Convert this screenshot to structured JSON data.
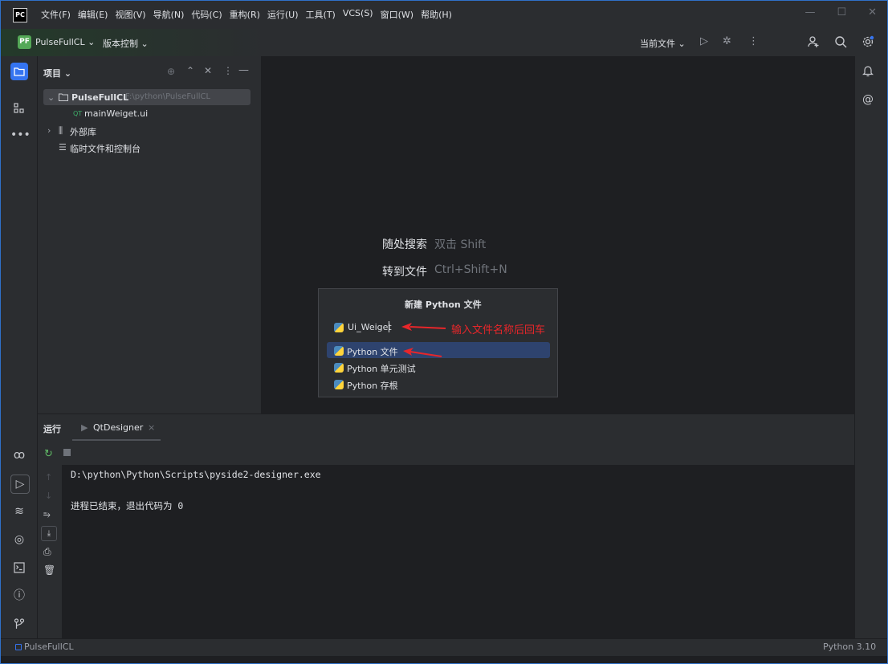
{
  "window": {
    "logo_text": "PC",
    "menu": [
      "文件(F)",
      "编辑(E)",
      "视图(V)",
      "导航(N)",
      "代码(C)",
      "重构(R)",
      "运行(U)",
      "工具(T)",
      "VCS(S)",
      "窗口(W)",
      "帮助(H)"
    ],
    "controls": {
      "minimize": "—",
      "maximize": "☐",
      "close": "✕"
    }
  },
  "toolbar": {
    "project_badge": "PF",
    "project_name": "PulseFullCL ⌄",
    "vcs_label": "版本控制 ⌄",
    "current_file": "当前文件 ⌄"
  },
  "project_panel": {
    "title": "项目 ⌄",
    "root_name": "PulseFullCL",
    "root_path": "F:\\python\\PulseFullCL",
    "file_badge": "QT",
    "file_name": "mainWeiget.ui",
    "external_libs": "外部库",
    "scratches": "临时文件和控制台"
  },
  "editor": {
    "hint1_label": "随处搜索",
    "hint1_key": "双击 Shift",
    "hint2_label": "转到文件",
    "hint2_key": "Ctrl+Shift+N"
  },
  "popup": {
    "title": "新建 Python 文件",
    "input_value": "Ui_Weiget",
    "items": [
      "Python 文件",
      "Python 单元测试",
      "Python 存根"
    ]
  },
  "annotation": {
    "text": "输入文件名称后回车",
    "color": "#e8262a"
  },
  "run_panel": {
    "tab_run": "运行",
    "tab_config": "QtDesigner",
    "tab_close": "×",
    "console_line1": "D:\\python\\Python\\Scripts\\pyside2-designer.exe",
    "console_line2": "进程已结束，退出代码为 0"
  },
  "statusbar": {
    "project": "PulseFullCL",
    "interpreter": "Python 3.10"
  }
}
